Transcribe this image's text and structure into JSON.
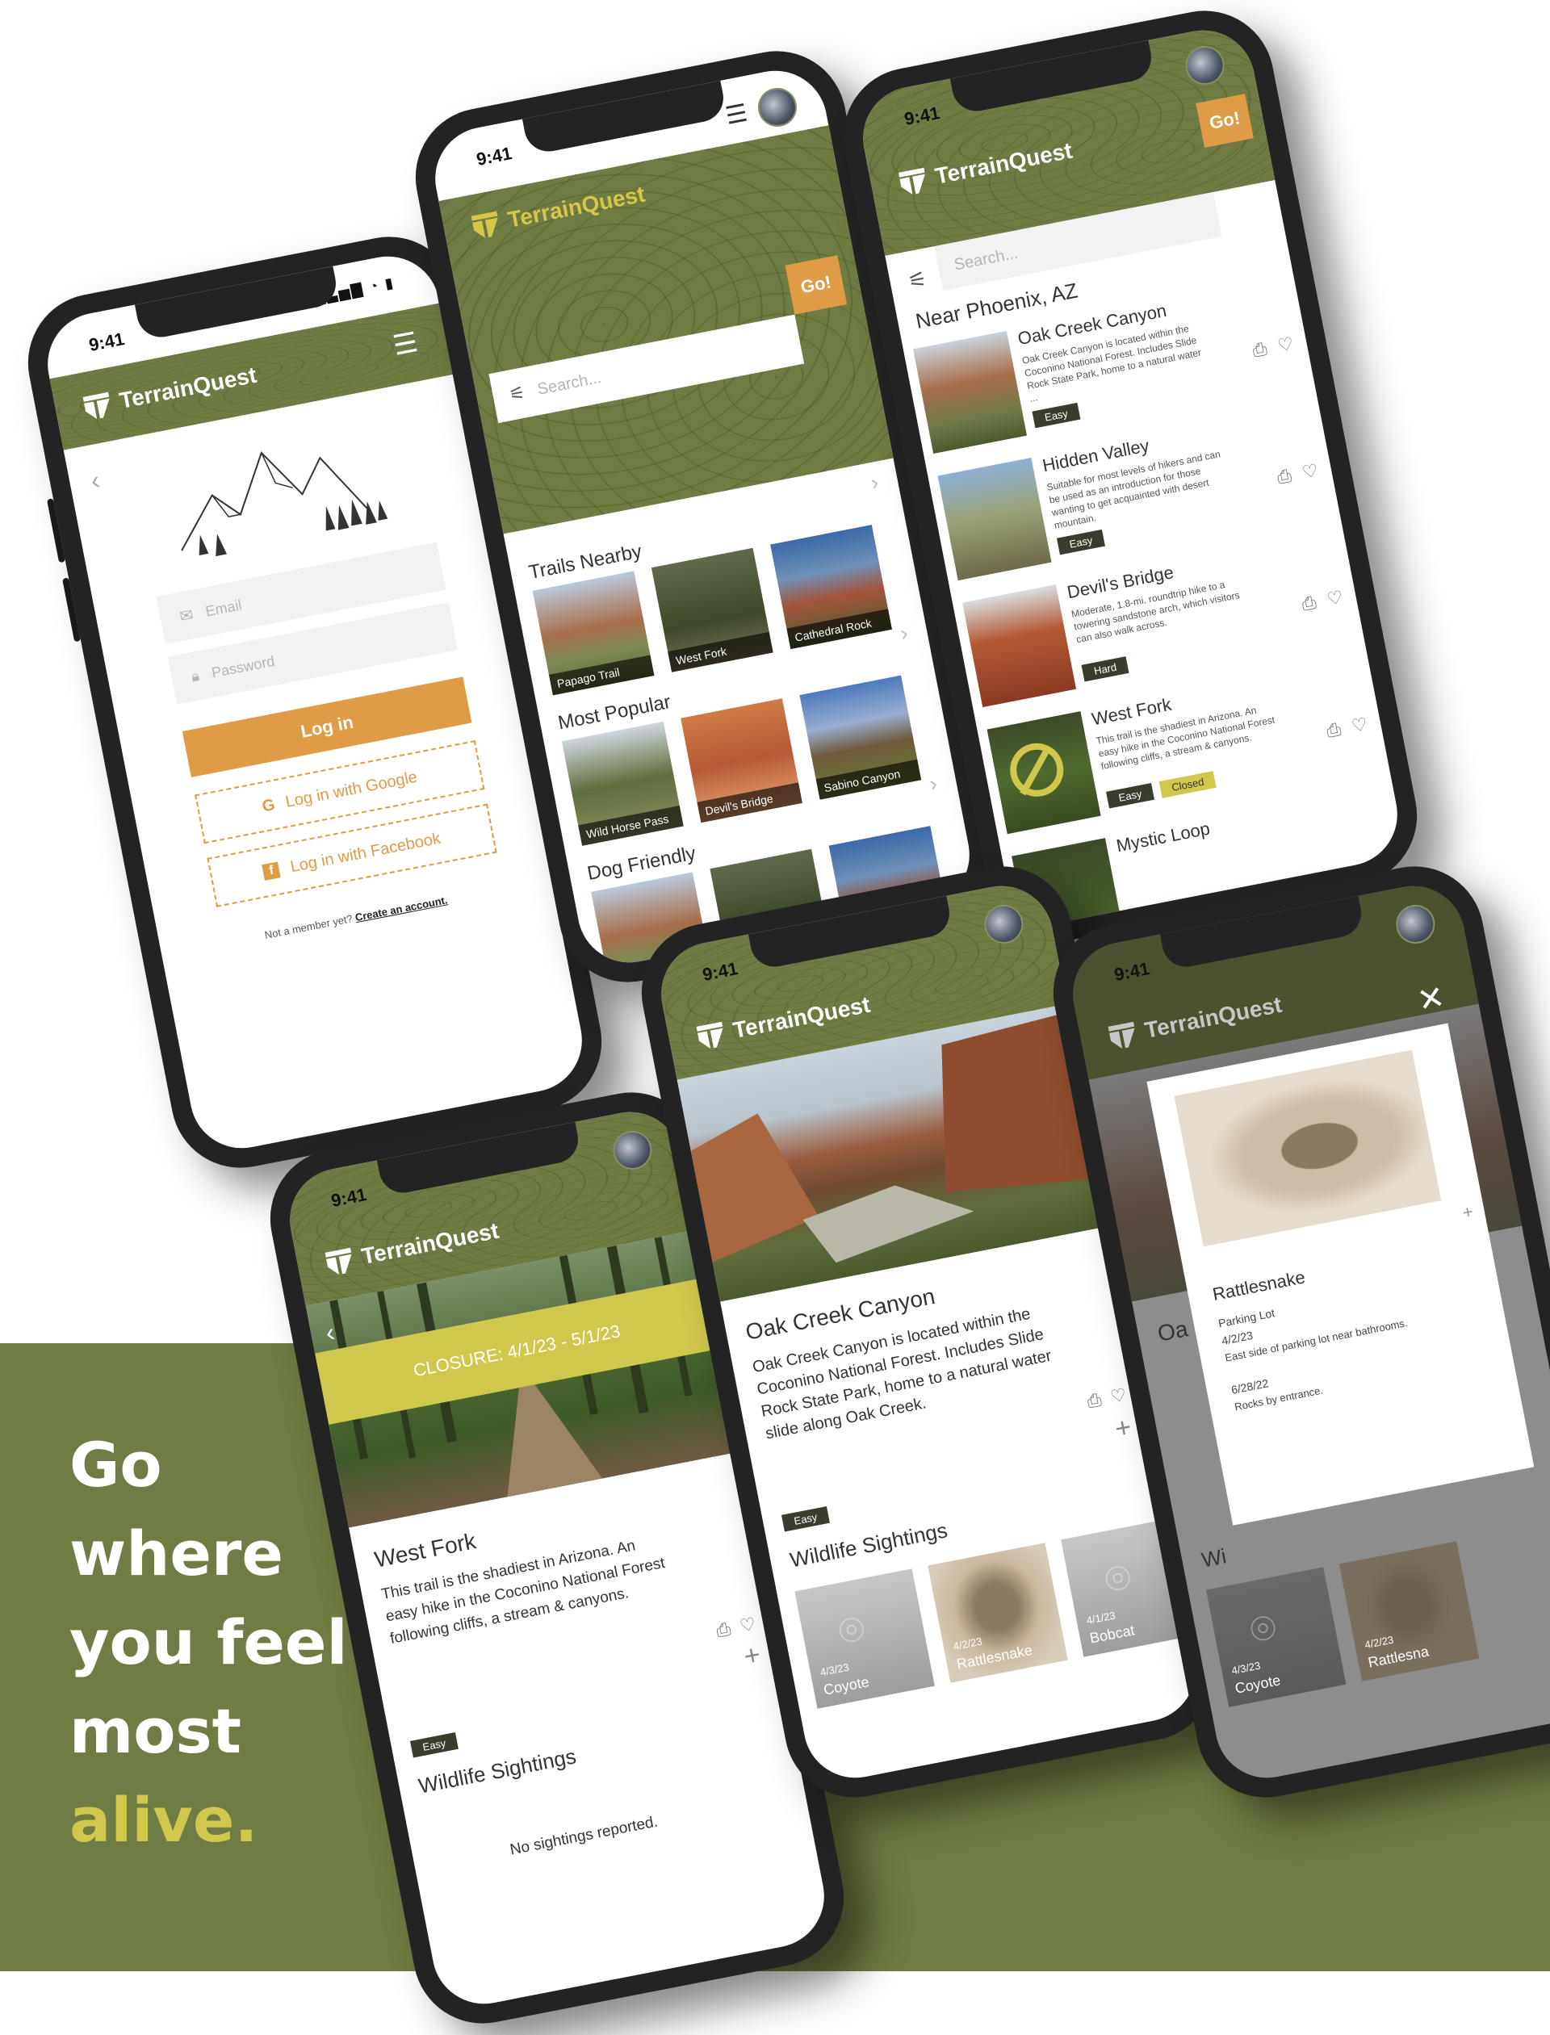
{
  "brand": {
    "name": "TerrainQuest"
  },
  "tagline": {
    "line1": "Go",
    "line2": "where",
    "line3": "you feel",
    "line4": "most",
    "accent": "alive."
  },
  "status": {
    "time": "9:41",
    "signal": "▁▃▅▇ ◔ ▮"
  },
  "login": {
    "email_placeholder": "Email",
    "password_placeholder": "Password",
    "login_button": "Log in",
    "google_button": "Log in with Google",
    "facebook_button": "Log in with Facebook",
    "signup_prompt": "Not a member yet?",
    "signup_link": "Create an account."
  },
  "home": {
    "search_placeholder": "Search...",
    "go_label": "Go!",
    "sections": [
      {
        "title": "Trails Nearby",
        "tiles": [
          "Papago Trail",
          "West Fork",
          "Cathedral Rock"
        ]
      },
      {
        "title": "Most Popular",
        "tiles": [
          "Wild Horse Pass",
          "Devil's Bridge",
          "Sabino Canyon"
        ]
      },
      {
        "title": "Dog Friendly",
        "tiles": [
          "",
          "",
          ""
        ]
      }
    ]
  },
  "results": {
    "search_placeholder": "Search...",
    "go_label": "Go!",
    "location_title": "Near Phoenix, AZ",
    "items": [
      {
        "title": "Oak Creek Canyon",
        "desc": "Oak Creek Canyon is located within the Coconino National Forest. Includes Slide Rock State Park, home to a natural water ...",
        "difficulty": "Easy",
        "status": ""
      },
      {
        "title": "Hidden Valley",
        "desc": "Suitable for most levels of hikers and can be used as an introduction for those wanting to get acquainted with desert mountain.",
        "difficulty": "Easy",
        "status": ""
      },
      {
        "title": "Devil's Bridge",
        "desc": "Moderate, 1.8-mi. roundtrip hike to a towering sandstone arch, which visitors can also walk across.",
        "difficulty": "Hard",
        "status": ""
      },
      {
        "title": "West Fork",
        "desc": "This trail is the shadiest in Arizona. An easy hike in the Coconino National Forest following cliffs, a stream & canyons.",
        "difficulty": "Easy",
        "status": "Closed"
      },
      {
        "title": "Mystic Loop",
        "desc": "",
        "difficulty": "",
        "status": ""
      }
    ]
  },
  "westfork": {
    "closure": "CLOSURE: 4/1/23 - 5/1/23",
    "title": "West Fork",
    "desc": "This trail is the shadiest in Arizona. An easy hike in the Coconino National Forest following cliffs, a stream & canyons.",
    "difficulty": "Easy",
    "wildlife_title": "Wildlife Sightings",
    "no_sightings": "No sightings reported."
  },
  "oakcreek": {
    "title": "Oak Creek Canyon",
    "desc": "Oak Creek Canyon is located within the Coconino National Forest. Includes Slide Rock State Park, home to a natural water slide along Oak Creek.",
    "difficulty": "Easy",
    "wildlife_title": "Wildlife Sightings",
    "sightings": [
      {
        "date": "4/3/23",
        "name": "Coyote"
      },
      {
        "date": "4/2/23",
        "name": "Rattlesnake"
      },
      {
        "date": "4/1/23",
        "name": "Bobcat"
      }
    ]
  },
  "modal": {
    "animal": "Rattlesnake",
    "reports": [
      {
        "location": "Parking Lot",
        "date": "4/2/23",
        "note": "East side of parking lot near bathrooms."
      },
      {
        "location": "",
        "date": "6/28/22",
        "note": "Rocks by entrance."
      }
    ],
    "behind_title_fragment": "Oa",
    "behind_wild_fragment": "Wi",
    "behind_sightings": [
      {
        "date": "4/3/23",
        "name": "Coyote"
      },
      {
        "date": "4/2/23",
        "name": "Rattlesna"
      }
    ]
  },
  "colors": {
    "olive": "#6f7c43",
    "orange": "#df9b45",
    "yellow": "#d0c84d",
    "dark": "#232323"
  }
}
